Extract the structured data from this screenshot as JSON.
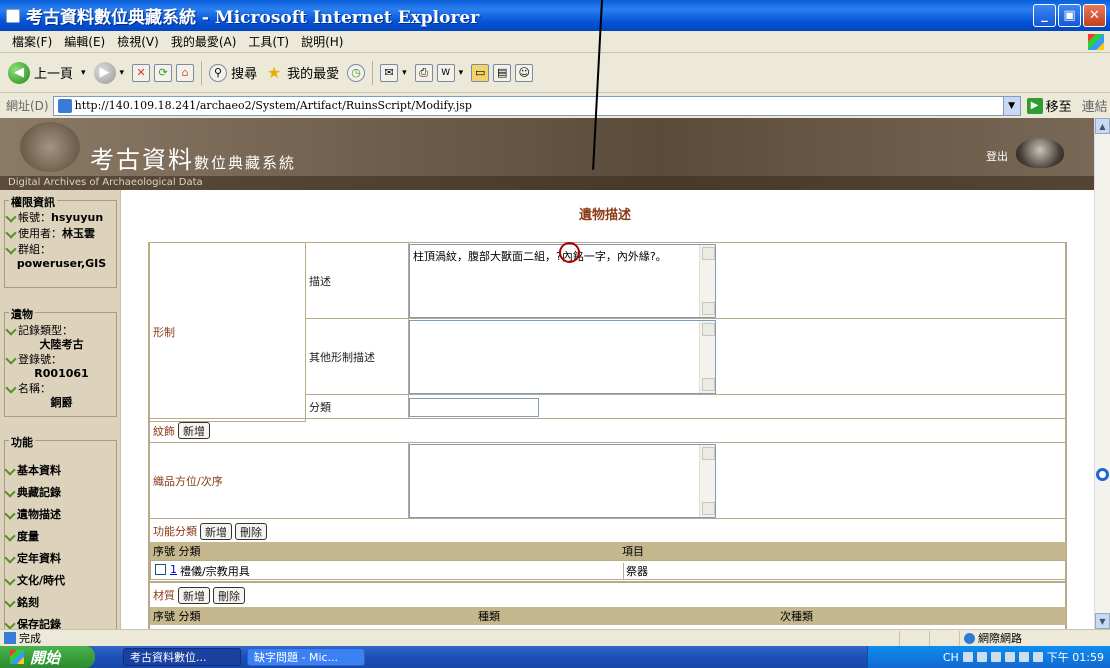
{
  "window": {
    "title": "考古資料數位典藏系統 - Microsoft Internet Explorer"
  },
  "menu": [
    "檔案(F)",
    "編輯(E)",
    "檢視(V)",
    "我的最愛(A)",
    "工具(T)",
    "說明(H)"
  ],
  "toolbar": {
    "back": "上一頁",
    "search": "搜尋",
    "favorites": "我的最愛"
  },
  "address": {
    "label": "網址(D)",
    "url": "http://140.109.18.241/archaeo2/System/Artifact/RuinsScript/Modify.jsp",
    "go": "移至",
    "links": "連結"
  },
  "banner": {
    "title_large": "考古資料",
    "title_small": "數位典藏系統",
    "subtitle": "Digital Archives of Archaeological Data",
    "logout": "登出"
  },
  "sidebar": {
    "perm_header": "權限資訊",
    "account_label": "帳號：",
    "account_value": "hsyuyun",
    "user_label": "使用者：",
    "user_value": "林玉雲",
    "group_label": "群組：",
    "group_value": "poweruser,GIS",
    "artifact_header": "遺物",
    "type_label": "記錄類型：",
    "type_value": "大陸考古",
    "regno_label": "登錄號：",
    "regno_value": "R001061",
    "name_label": "名稱：",
    "name_value": "銅爵",
    "func_header": "功能",
    "functions": [
      "基本資料",
      "典藏記錄",
      "遺物描述",
      "度量",
      "定年資料",
      "文化/時代",
      "銘刻",
      "保存記錄"
    ]
  },
  "form": {
    "heading": "遺物描述",
    "shape_label": "形制",
    "desc_label": "描述",
    "desc_value": "柱頂渦紋，腹部大獸面二組，?內銘一字，內外緣?。",
    "other_label": "其他形制描述",
    "other_value": "",
    "class_label": "分類",
    "class_value": "",
    "pattern_label": "紋飾",
    "add_label": "新增",
    "delete_label": "刪除",
    "pos_label": "織品方位/次序",
    "pos_value": "",
    "func_class_label": "功能分類",
    "func_header": {
      "seq": "序號 分類",
      "item": "項目"
    },
    "func_rows": [
      {
        "seq": "1",
        "category": "禮儀/宗教用具",
        "item": "祭器"
      }
    ],
    "material_label": "材質",
    "mat_header": {
      "seq": "序號 分類",
      "sub": "種類",
      "sub2": "次種類"
    }
  },
  "status": {
    "done": "完成",
    "zone": "網際網路"
  },
  "taskbar": {
    "start": "開始",
    "tasks": [
      "考古資料數位...",
      "缺字問題 - Mic..."
    ],
    "clock": "下午 01:59",
    "ime": "CH"
  }
}
